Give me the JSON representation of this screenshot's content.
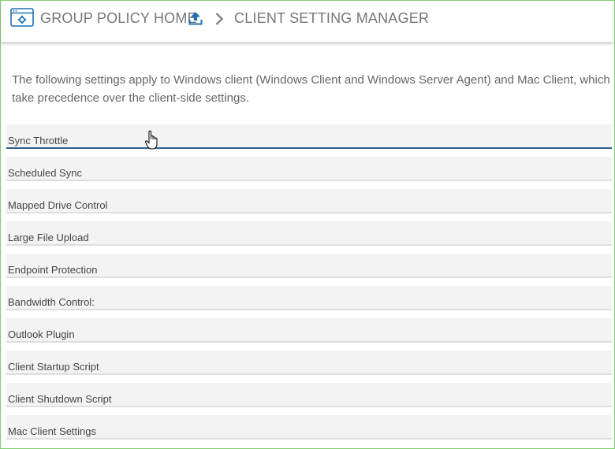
{
  "breadcrumb": {
    "home_label": "GROUP POLICY HOME",
    "current_label": "CLIENT SETTING MANAGER"
  },
  "icons": {
    "app": "settings-window-icon",
    "upload": "upload-icon",
    "separator": "chevron-right-icon",
    "cursor": "hand-pointer-icon"
  },
  "colors": {
    "accent": "#1f6fb2",
    "active_underline": "#2b5f8a",
    "frame_border": "#7fd06f"
  },
  "description": "The following settings apply to Windows client (Windows Client and Windows Server Agent) and Mac Client, which take precedence over the client-side settings.",
  "settings": [
    {
      "label": "Sync Throttle"
    },
    {
      "label": "Scheduled Sync"
    },
    {
      "label": "Mapped Drive Control"
    },
    {
      "label": "Large File Upload"
    },
    {
      "label": "Endpoint Protection"
    },
    {
      "label": "Bandwidth Control:"
    },
    {
      "label": "Outlook Plugin"
    },
    {
      "label": "Client Startup Script"
    },
    {
      "label": "Client Shutdown Script"
    },
    {
      "label": "Mac Client Settings"
    }
  ]
}
